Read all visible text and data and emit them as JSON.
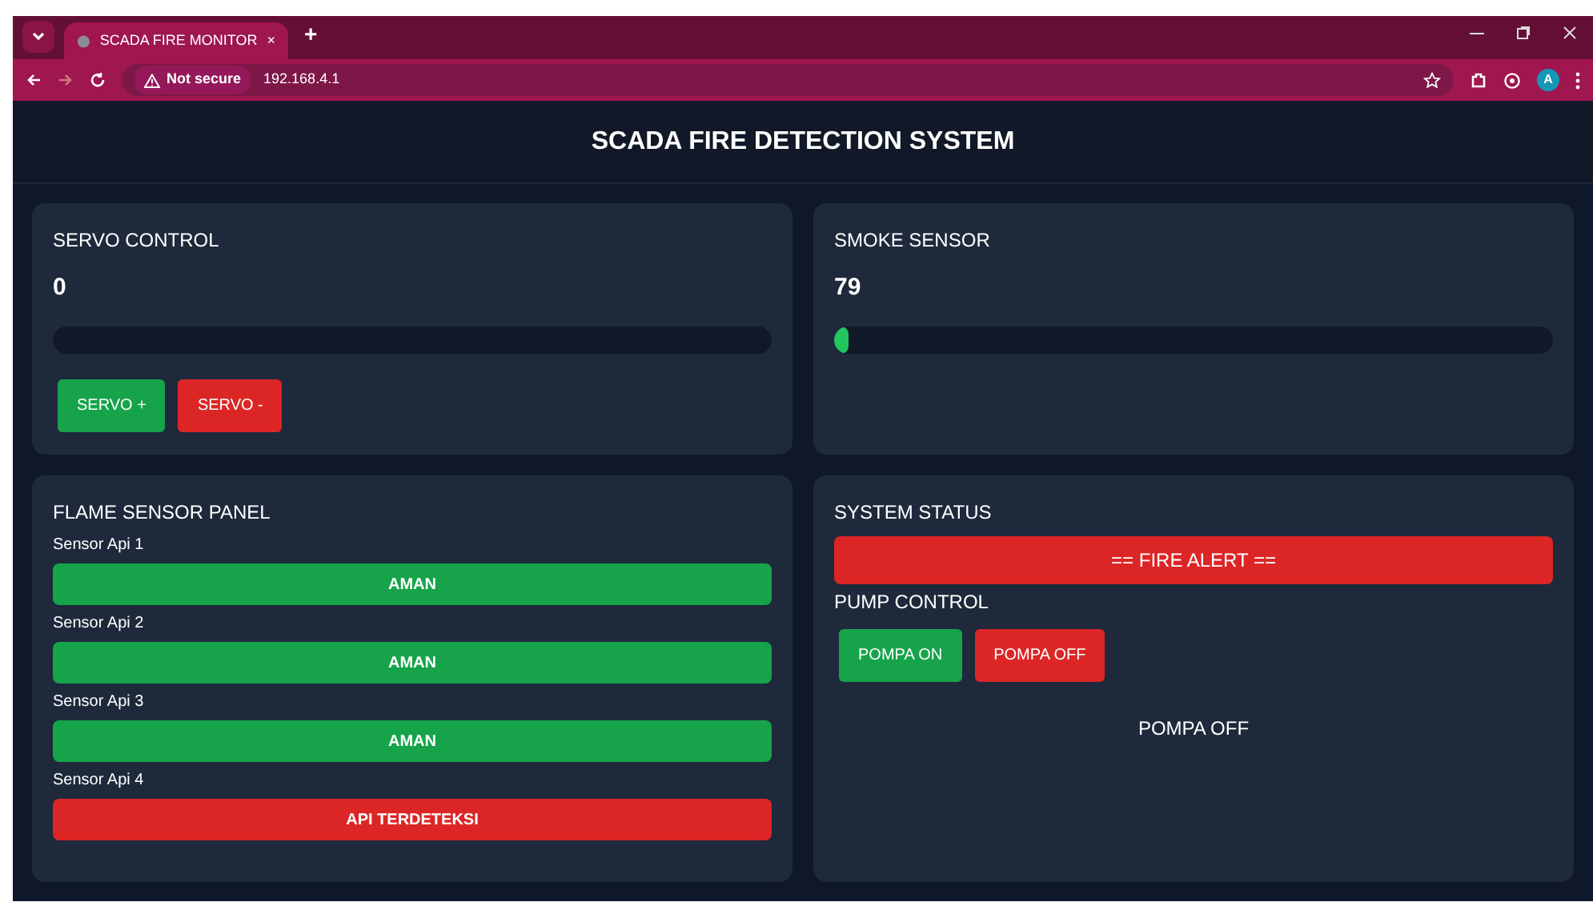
{
  "browser": {
    "tab_title": "SCADA FIRE MONITOR",
    "new_tab": "+",
    "close_tab": "×",
    "security": "Not secure",
    "address": "192.168.4.1",
    "profile": "A"
  },
  "header": {
    "title": "SCADA FIRE DETECTION SYSTEM"
  },
  "servo": {
    "title": "SERVO CONTROL",
    "value": "0",
    "buttons": [
      {
        "label": "SERVO +",
        "kind": "go"
      },
      {
        "label": "SERVO -",
        "kind": "stop"
      }
    ]
  },
  "smoke": {
    "title": "SMOKE SENSOR",
    "value": "79",
    "level": 0.02
  },
  "flame": {
    "title": "FLAME SENSOR PANEL",
    "sensors": [
      {
        "label": "Sensor Api 1",
        "status": "AMAN",
        "alarm": false
      },
      {
        "label": "Sensor Api 2",
        "status": "AMAN",
        "alarm": false
      },
      {
        "label": "Sensor Api 3",
        "status": "AMAN",
        "alarm": false
      },
      {
        "label": "Sensor Api 4",
        "status": "API TERDETEKSI",
        "alarm": true
      }
    ]
  },
  "system": {
    "title": "SYSTEM STATUS",
    "alert": "== FIRE ALERT ==",
    "alarm": true,
    "pump_title": "PUMP CONTROL",
    "buttons": [
      {
        "label": "POMPA ON",
        "kind": "go"
      },
      {
        "label": "POMPA OFF",
        "kind": "stop"
      }
    ],
    "pump_status": "POMPA OFF"
  }
}
